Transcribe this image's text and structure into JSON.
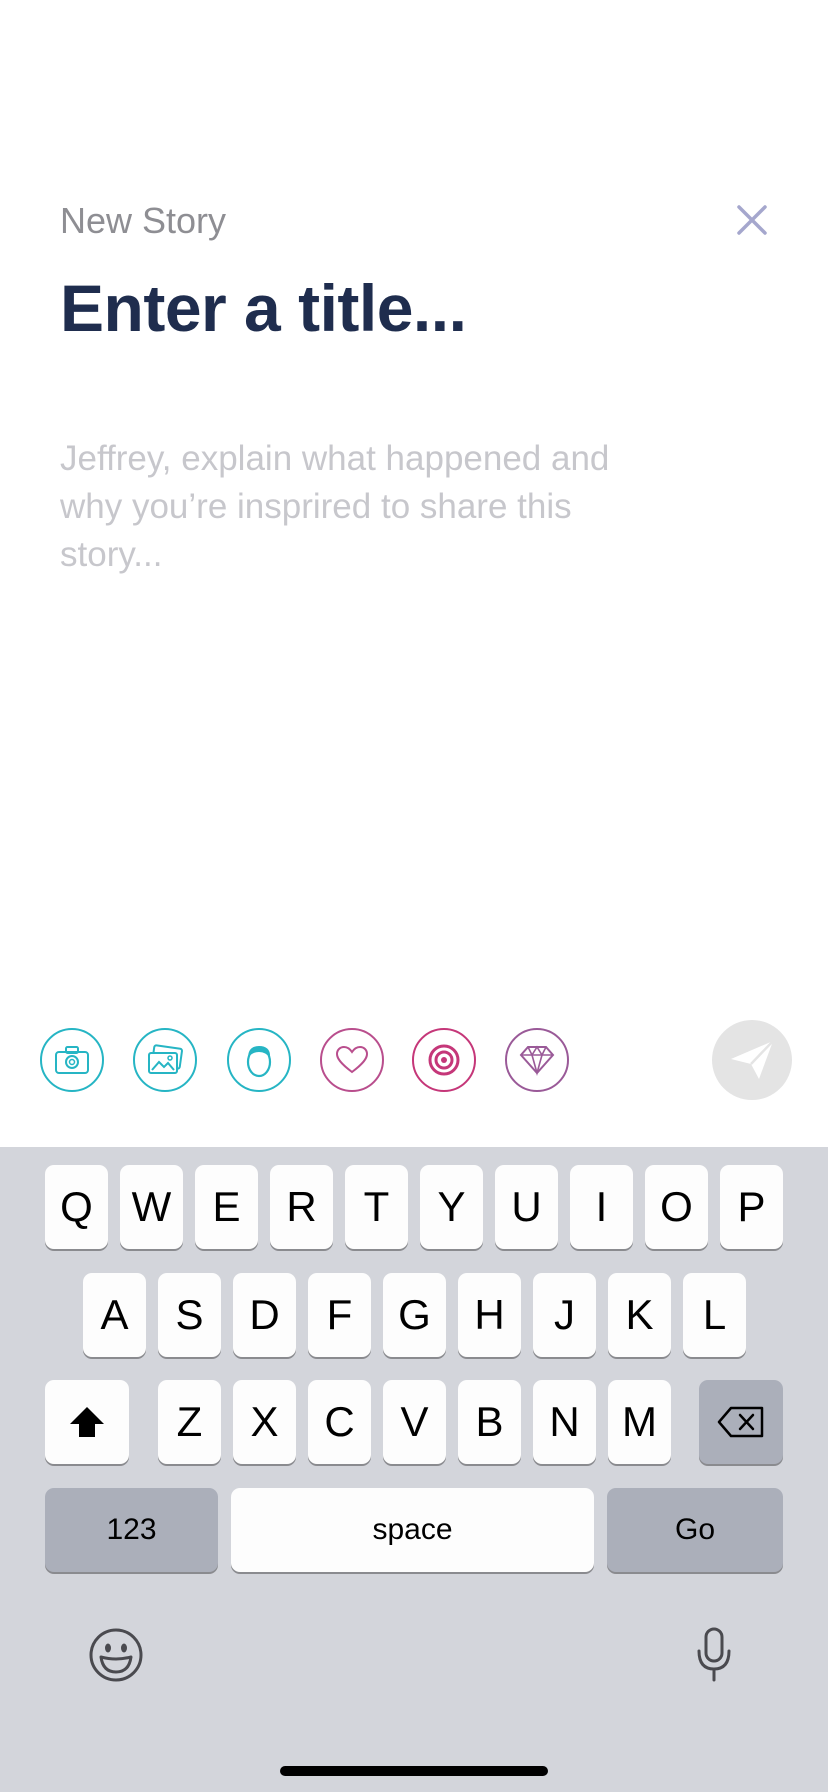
{
  "header": {
    "label": "New Story",
    "close_icon": "close-icon"
  },
  "title_input": {
    "placeholder": "Enter a title..."
  },
  "body_input": {
    "placeholder": "Jeffrey, explain what happened and why you’re insprired to share this story..."
  },
  "toolbar": {
    "tools": [
      {
        "name": "camera-icon",
        "color": "#26b5c4"
      },
      {
        "name": "gallery-icon",
        "color": "#26b5c4"
      },
      {
        "name": "person-icon",
        "color": "#26b5c4"
      },
      {
        "name": "heart-icon",
        "color": "#b94e8d"
      },
      {
        "name": "target-icon",
        "color": "#c53779"
      },
      {
        "name": "diamond-icon",
        "color": "#9a5a98"
      }
    ],
    "send_icon": "paper-plane-icon",
    "send_color": "#e4e4e4"
  },
  "keyboard": {
    "row1": [
      "Q",
      "W",
      "E",
      "R",
      "T",
      "Y",
      "U",
      "I",
      "O",
      "P"
    ],
    "row2": [
      "A",
      "S",
      "D",
      "F",
      "G",
      "H",
      "J",
      "K",
      "L"
    ],
    "row3": [
      "Z",
      "X",
      "C",
      "V",
      "B",
      "N",
      "M"
    ],
    "numbers_label": "123",
    "space_label": "space",
    "go_label": "Go",
    "shift_icon": "shift-icon",
    "delete_icon": "delete-icon",
    "emoji_icon": "emoji-icon",
    "mic_icon": "microphone-icon"
  }
}
